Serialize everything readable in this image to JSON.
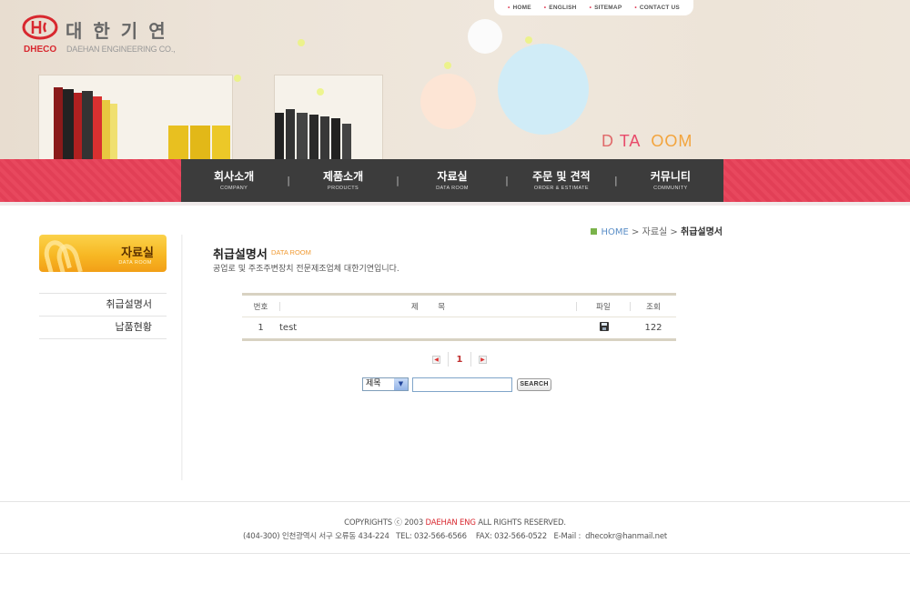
{
  "header": {
    "logo_abbr": "DHECO",
    "logo_korean": "대한기연",
    "logo_english": "DAEHAN ENGINEERING CO.,",
    "top_links": [
      "HOME",
      "ENGLISH",
      "SITEMAP",
      "CONTACT US"
    ],
    "hero_title": {
      "p1": "D",
      "p2": "TA",
      "p3": "OOM"
    },
    "colors": {
      "accent_red": "#d8282f",
      "hero_d": "#e06a6a",
      "hero_ta": "#e84a6a",
      "hero_oom": "#f3a43c"
    }
  },
  "main_nav": [
    {
      "ko": "회사소개",
      "en": "COMPANY"
    },
    {
      "ko": "제품소개",
      "en": "PRODUCTS"
    },
    {
      "ko": "자료실",
      "en": "DATA ROOM"
    },
    {
      "ko": "주문 및 견적",
      "en": "ORDER & ESTIMATE"
    },
    {
      "ko": "커뮤니티",
      "en": "COMMUNITY"
    }
  ],
  "nav_separator": "|",
  "sidebar": {
    "title_ko": "자료실",
    "title_en": "DATA ROOM",
    "items": [
      "취급설명서",
      "납품현황"
    ]
  },
  "breadcrumb": {
    "home": "HOME",
    "sep": ">",
    "section": "자료실",
    "current": "취급설명서"
  },
  "page": {
    "title": "취급설명서",
    "title_en": "DATA ROOM",
    "description": "공업로 및 주조주변장치 전문제조업체 대한기연입니다."
  },
  "board": {
    "headers": {
      "no": "번호",
      "title": "제        목",
      "file": "파일",
      "views": "조회"
    },
    "rows": [
      {
        "no": "1",
        "title": "test",
        "file_icon": "disk-icon",
        "views": "122"
      }
    ]
  },
  "pager": {
    "current": "1",
    "prev": "◀",
    "next": "▶"
  },
  "search": {
    "field_value": "제목",
    "field_arrow": "▼",
    "button": "SEARCH"
  },
  "footer": {
    "copyright_prefix": "COPYRIGHTS  ⓒ 2003",
    "company": "DAEHAN ENG",
    "copyright_suffix": "ALL RIGHTS RESERVED.",
    "address": "(404-300) 인천광역시 서구 오류동 434-224   TEL: 032-566-6566    FAX: 032-566-0522   E-Mail :  dhecokr@hanmail.net"
  }
}
